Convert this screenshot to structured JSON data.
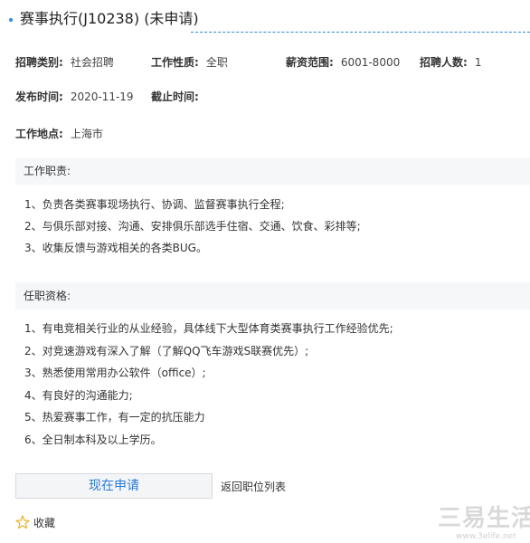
{
  "job": {
    "title": "赛事执行(J10238) (未申请)"
  },
  "fields": {
    "category_label": "招聘类别:",
    "category_value": "社会招聘",
    "nature_label": "工作性质:",
    "nature_value": "全职",
    "salary_label": "薪资范围:",
    "salary_value": "6001-8000",
    "headcount_label": "招聘人数:",
    "headcount_value": "1",
    "publish_label": "发布时间:",
    "publish_value": "2020-11-19",
    "deadline_label": "截止时间:",
    "deadline_value": "",
    "location_label": "工作地点:",
    "location_value": "上海市"
  },
  "duties": {
    "heading": "工作职责:",
    "items": [
      "1、负责各类赛事现场执行、协调、监督赛事执行全程;",
      "2、与俱乐部对接、沟通、安排俱乐部选手住宿、交通、饮食、彩排等;",
      "3、收集反馈与游戏相关的各类BUG。"
    ]
  },
  "requirements": {
    "heading": "任职资格:",
    "items": [
      "1、有电竞相关行业的从业经验，具体线下大型体育类赛事执行工作经验优先;",
      "2、对竞速游戏有深入了解（了解QQ飞车游戏S联赛优先）;",
      "3、熟悉使用常用办公软件（office）;",
      "4、有良好的沟通能力;",
      "5、热爱赛事工作，有一定的抗压能力",
      "6、全日制本科及以上学历。"
    ]
  },
  "actions": {
    "apply_label": "现在申请",
    "back_label": "返回职位列表",
    "favorite_label": "收藏"
  },
  "watermark": {
    "text": "三易生活",
    "url": "www.3elife.net"
  },
  "colors": {
    "accent": "#2b8ae0",
    "apply_text": "#2b7bd6",
    "section_bg": "#f6f7f9",
    "star": "#e6b422"
  },
  "icons": {
    "title_marker": "dot-icon",
    "favorite": "star-outline-icon"
  }
}
